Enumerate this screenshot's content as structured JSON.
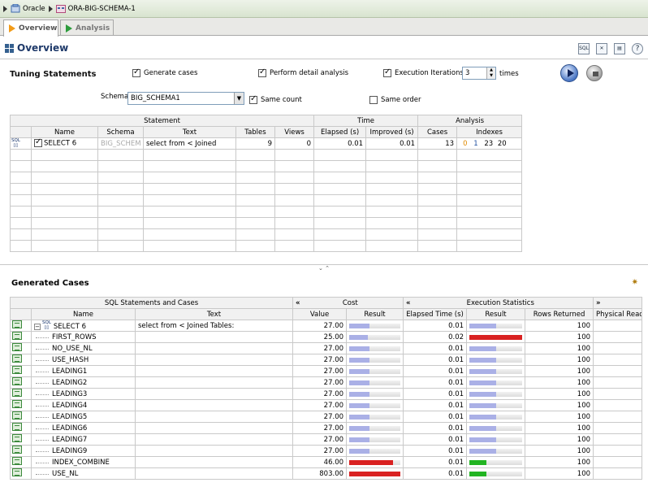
{
  "breadcrumb": {
    "items": [
      "Oracle",
      "ORA-BIG-SCHEMA-1"
    ]
  },
  "tabs": [
    {
      "label": "Overview"
    },
    {
      "label": "Analysis"
    }
  ],
  "overview": {
    "title": "Overview"
  },
  "toolbar": {
    "icons": [
      "sql-icon",
      "delete-icon",
      "copy-icon",
      "help-icon"
    ],
    "help_label": "?",
    "sql_label": "SQL"
  },
  "tuning": {
    "title": "Tuning Statements",
    "generate_cases": {
      "label": "Generate cases",
      "checked": true
    },
    "detail_analysis": {
      "label": "Perform detail analysis",
      "checked": true
    },
    "exec_iterations": {
      "label": "Execution Iterations",
      "checked": true,
      "value": "3",
      "unit": "times"
    },
    "schema": {
      "label": "Schema",
      "value": "BIG_SCHEMA1"
    },
    "same_count": {
      "label": "Same count",
      "checked": true
    },
    "same_order": {
      "label": "Same order",
      "checked": false
    }
  },
  "statements_table": {
    "group_headers": [
      "Statement",
      "Time",
      "Analysis"
    ],
    "columns": [
      "Name",
      "Schema",
      "Text",
      "Tables",
      "Views",
      "Elapsed (s)",
      "Improved (s)",
      "Cases",
      "Indexes"
    ],
    "rows": [
      {
        "name": "SELECT 6",
        "schema": "BIG_SCHEM",
        "text": "select from < Joined",
        "tables": "9",
        "views": "0",
        "elapsed": "0.01",
        "improved": "0.01",
        "cases": "13",
        "idx0": "0",
        "idx1": "1",
        "idx2": "23",
        "idx3": "20"
      }
    ]
  },
  "generated": {
    "title": "Generated Cases",
    "group_headers": {
      "sql": "SQL Statements and Cases",
      "cost": "Cost",
      "exec": "Execution Statistics",
      "chev": "«",
      "chev_right": "»"
    },
    "columns": {
      "name": "Name",
      "text": "Text",
      "value": "Value",
      "result": "Result",
      "elapsed": "Elapsed Time (s)",
      "result2": "Result",
      "rows": "Rows Returned",
      "phys": "Physical Reads"
    },
    "rows": [
      {
        "name": "SELECT 6",
        "text": "select from < Joined Tables:",
        "cost": "27.00",
        "cost_frac": 0.4,
        "cost_color": "#aab0e6",
        "elapsed": "0.01",
        "exec_frac": 0.5,
        "exec_color": "#aab0e6",
        "rows": "100"
      },
      {
        "name": "FIRST_ROWS",
        "text": "",
        "cost": "25.00",
        "cost_frac": 0.37,
        "cost_color": "#aab0e6",
        "elapsed": "0.02",
        "exec_frac": 1.0,
        "exec_color": "#d92121",
        "rows": "100"
      },
      {
        "name": "NO_USE_NL",
        "text": "",
        "cost": "27.00",
        "cost_frac": 0.4,
        "cost_color": "#aab0e6",
        "elapsed": "0.01",
        "exec_frac": 0.5,
        "exec_color": "#aab0e6",
        "rows": "100"
      },
      {
        "name": "USE_HASH",
        "text": "",
        "cost": "27.00",
        "cost_frac": 0.4,
        "cost_color": "#aab0e6",
        "elapsed": "0.01",
        "exec_frac": 0.5,
        "exec_color": "#aab0e6",
        "rows": "100"
      },
      {
        "name": "LEADING1",
        "text": "",
        "cost": "27.00",
        "cost_frac": 0.4,
        "cost_color": "#aab0e6",
        "elapsed": "0.01",
        "exec_frac": 0.5,
        "exec_color": "#aab0e6",
        "rows": "100"
      },
      {
        "name": "LEADING2",
        "text": "",
        "cost": "27.00",
        "cost_frac": 0.4,
        "cost_color": "#aab0e6",
        "elapsed": "0.01",
        "exec_frac": 0.5,
        "exec_color": "#aab0e6",
        "rows": "100"
      },
      {
        "name": "LEADING3",
        "text": "",
        "cost": "27.00",
        "cost_frac": 0.4,
        "cost_color": "#aab0e6",
        "elapsed": "0.01",
        "exec_frac": 0.5,
        "exec_color": "#aab0e6",
        "rows": "100"
      },
      {
        "name": "LEADING4",
        "text": "",
        "cost": "27.00",
        "cost_frac": 0.4,
        "cost_color": "#aab0e6",
        "elapsed": "0.01",
        "exec_frac": 0.5,
        "exec_color": "#aab0e6",
        "rows": "100"
      },
      {
        "name": "LEADING5",
        "text": "",
        "cost": "27.00",
        "cost_frac": 0.4,
        "cost_color": "#aab0e6",
        "elapsed": "0.01",
        "exec_frac": 0.5,
        "exec_color": "#aab0e6",
        "rows": "100"
      },
      {
        "name": "LEADING6",
        "text": "",
        "cost": "27.00",
        "cost_frac": 0.4,
        "cost_color": "#aab0e6",
        "elapsed": "0.01",
        "exec_frac": 0.5,
        "exec_color": "#aab0e6",
        "rows": "100"
      },
      {
        "name": "LEADING7",
        "text": "",
        "cost": "27.00",
        "cost_frac": 0.4,
        "cost_color": "#aab0e6",
        "elapsed": "0.01",
        "exec_frac": 0.5,
        "exec_color": "#aab0e6",
        "rows": "100"
      },
      {
        "name": "LEADING9",
        "text": "",
        "cost": "27.00",
        "cost_frac": 0.4,
        "cost_color": "#aab0e6",
        "elapsed": "0.01",
        "exec_frac": 0.5,
        "exec_color": "#aab0e6",
        "rows": "100"
      },
      {
        "name": "INDEX_COMBINE",
        "text": "",
        "cost": "46.00",
        "cost_frac": 0.85,
        "cost_color": "#d92121",
        "elapsed": "0.01",
        "exec_frac": 0.33,
        "exec_color": "#22b422",
        "rows": "100"
      },
      {
        "name": "USE_NL",
        "text": "",
        "cost": "803.00",
        "cost_frac": 1.0,
        "cost_color": "#d92121",
        "elapsed": "0.01",
        "exec_frac": 0.33,
        "exec_color": "#22b422",
        "rows": "100"
      }
    ]
  }
}
